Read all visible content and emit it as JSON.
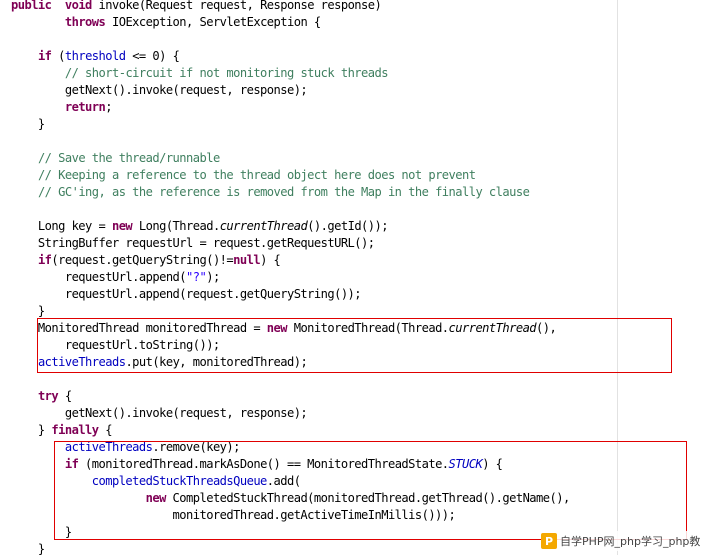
{
  "editor": {
    "lines": [
      [
        [
          "kw",
          "public"
        ],
        [
          "",
          "  "
        ],
        [
          "kw",
          "void"
        ],
        [
          "",
          " invoke(Request request, Response response)"
        ]
      ],
      [
        [
          "",
          "        "
        ],
        [
          "kw",
          "throws"
        ],
        [
          "",
          " IOException, ServletException {"
        ]
      ],
      [
        [
          "",
          ""
        ]
      ],
      [
        [
          "",
          "    "
        ],
        [
          "kw",
          "if"
        ],
        [
          "",
          " ("
        ],
        [
          "fd",
          "threshold"
        ],
        [
          "",
          " <= 0) {"
        ]
      ],
      [
        [
          "",
          "        "
        ],
        [
          "cm",
          "// short-circuit if not monitoring stuck threads"
        ]
      ],
      [
        [
          "",
          "        getNext().invoke(request, response);"
        ]
      ],
      [
        [
          "",
          "        "
        ],
        [
          "kw",
          "return"
        ],
        [
          "",
          ";"
        ]
      ],
      [
        [
          "",
          "    }"
        ]
      ],
      [
        [
          "",
          ""
        ]
      ],
      [
        [
          "",
          "    "
        ],
        [
          "cm",
          "// Save the thread/runnable"
        ]
      ],
      [
        [
          "",
          "    "
        ],
        [
          "cm",
          "// Keeping a reference to the thread object here does not prevent"
        ]
      ],
      [
        [
          "",
          "    "
        ],
        [
          "cm",
          "// GC'ing, as the reference is removed from the Map in the finally clause"
        ]
      ],
      [
        [
          "",
          ""
        ]
      ],
      [
        [
          "",
          "    Long key = "
        ],
        [
          "kw",
          "new"
        ],
        [
          "",
          " Long(Thread."
        ],
        [
          "it",
          "currentThread"
        ],
        [
          "",
          "().getId());"
        ]
      ],
      [
        [
          "",
          "    StringBuffer requestUrl = request.getRequestURL();"
        ]
      ],
      [
        [
          "",
          "    "
        ],
        [
          "kw",
          "if"
        ],
        [
          "",
          "(request.getQueryString()!="
        ],
        [
          "kw",
          "null"
        ],
        [
          "",
          ") {"
        ]
      ],
      [
        [
          "",
          "        requestUrl.append("
        ],
        [
          "st",
          "\"?\""
        ],
        [
          "",
          ");"
        ]
      ],
      [
        [
          "",
          "        requestUrl.append(request.getQueryString());"
        ]
      ],
      [
        [
          "",
          "    }"
        ]
      ],
      [
        [
          "",
          "    MonitoredThread monitoredThread = "
        ],
        [
          "kw",
          "new"
        ],
        [
          "",
          " MonitoredThread(Thread."
        ],
        [
          "it",
          "currentThread"
        ],
        [
          "",
          "(),"
        ]
      ],
      [
        [
          "",
          "        requestUrl.toString());"
        ]
      ],
      [
        [
          "",
          "    "
        ],
        [
          "fd",
          "activeThreads"
        ],
        [
          "",
          ".put(key, monitoredThread);"
        ]
      ],
      [
        [
          "",
          ""
        ]
      ],
      [
        [
          "",
          "    "
        ],
        [
          "kw",
          "try"
        ],
        [
          "",
          " {"
        ]
      ],
      [
        [
          "",
          "        getNext().invoke(request, response);"
        ]
      ],
      [
        [
          "",
          "    } "
        ],
        [
          "kw",
          "finally"
        ],
        [
          "",
          " {"
        ]
      ],
      [
        [
          "",
          "        "
        ],
        [
          "fd",
          "activeThreads"
        ],
        [
          "",
          ".remove(key);"
        ]
      ],
      [
        [
          "",
          "        "
        ],
        [
          "kw",
          "if"
        ],
        [
          "",
          " (monitoredThread.markAsDone() == MonitoredThreadState."
        ],
        [
          "sf",
          "STUCK"
        ],
        [
          "",
          ") {"
        ]
      ],
      [
        [
          "",
          "            "
        ],
        [
          "fd",
          "completedStuckThreadsQueue"
        ],
        [
          "",
          ".add("
        ]
      ],
      [
        [
          "",
          "                    "
        ],
        [
          "kw",
          "new"
        ],
        [
          "",
          " CompletedStuckThread(monitoredThread.getThread().getName(),"
        ]
      ],
      [
        [
          "",
          "                        monitoredThread.getActiveTimeInMillis()));"
        ]
      ],
      [
        [
          "",
          "        }"
        ]
      ],
      [
        [
          "",
          "    }"
        ]
      ]
    ]
  },
  "highlights": [
    {
      "name": "highlight-box-monitored-thread"
    },
    {
      "name": "highlight-box-finally-block"
    }
  ],
  "watermark": {
    "logo_text": "P",
    "text": "自学PHP网_php学习_php教"
  }
}
